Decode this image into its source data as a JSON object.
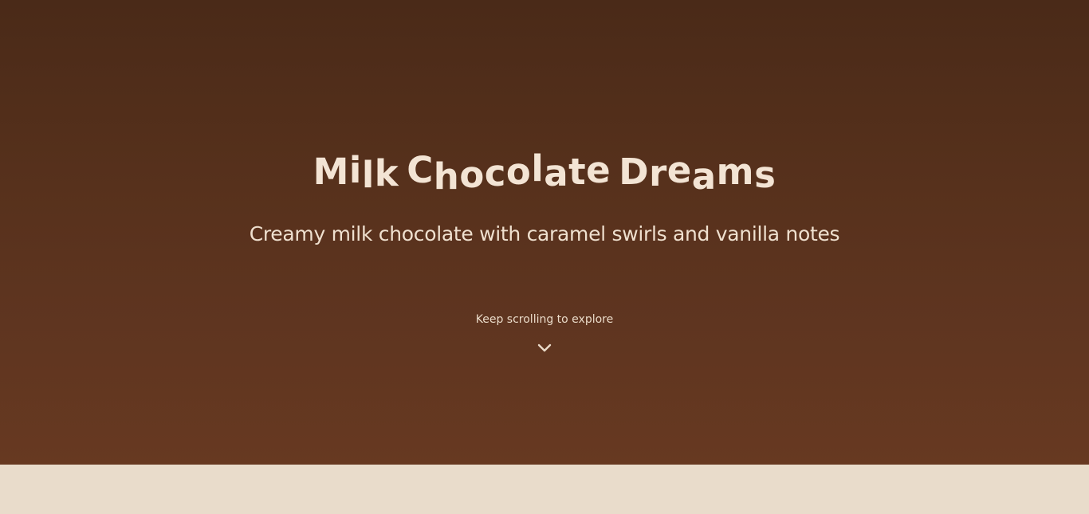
{
  "hero": {
    "title": "Milk Chocolate Dreams",
    "subtitle": "Creamy milk chocolate with caramel swirls and vanilla notes",
    "scroll_hint": "Keep scrolling to explore",
    "scroll_icon": "chevron-down-icon"
  },
  "colors": {
    "hero_top": "#4a2a18",
    "hero_bottom": "#673921",
    "text": "#f3e4d4",
    "section_background": "#e9dccb"
  }
}
